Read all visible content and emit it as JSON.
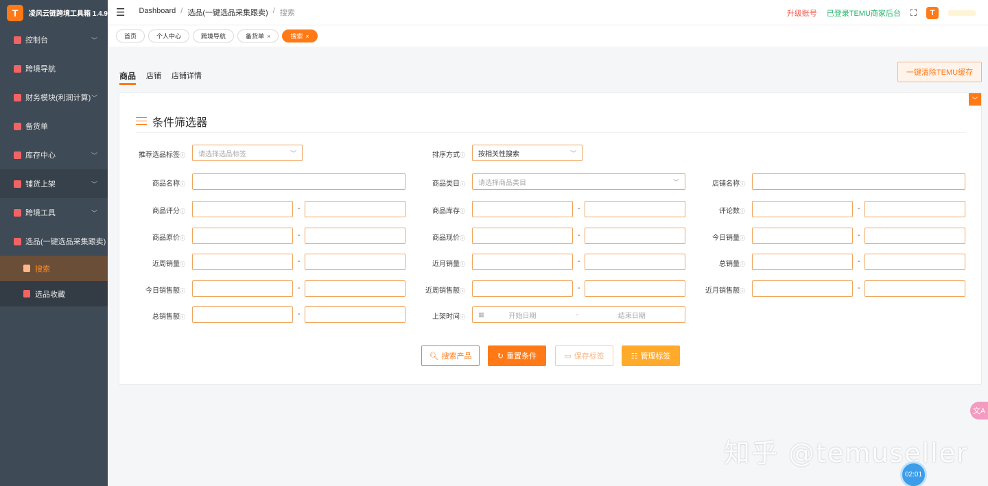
{
  "app": {
    "title": "凌风云链跨境工具箱 1.4.9",
    "logo_letter": "T"
  },
  "sidebar": {
    "items": [
      {
        "label": "控制台",
        "chevron": true
      },
      {
        "label": "跨境导航",
        "chevron": false
      },
      {
        "label": "财务模块(利润计算)",
        "chevron": true
      },
      {
        "label": "备货单",
        "chevron": false
      },
      {
        "label": "库存中心",
        "chevron": true
      },
      {
        "label": "铺货上架",
        "chevron": true
      },
      {
        "label": "跨境工具",
        "chevron": true
      },
      {
        "label": "选品(一键选品采集跟卖)",
        "chevron": false
      }
    ],
    "sub_items": [
      {
        "label": "搜索",
        "active": true
      },
      {
        "label": "选品收藏",
        "active": false
      }
    ]
  },
  "topbar": {
    "breadcrumb": [
      "Dashboard",
      "选品(一键选品采集跟卖)",
      "搜索"
    ],
    "upgrade": "升级账号",
    "logged_in": "已登录TEMU商家后台",
    "avatar_letter": "T"
  },
  "tags": [
    {
      "label": "首页",
      "closable": false,
      "active": false
    },
    {
      "label": "个人中心",
      "closable": false,
      "active": false
    },
    {
      "label": "跨境导航",
      "closable": false,
      "active": false
    },
    {
      "label": "备货单",
      "closable": true,
      "active": false
    },
    {
      "label": "搜索",
      "closable": true,
      "active": true
    }
  ],
  "subtabs": [
    "商品",
    "店铺",
    "店铺详情"
  ],
  "clear_cache_label": "一键清除TEMU缓存",
  "filter": {
    "title": "条件筛选器",
    "recommend_tag": {
      "label": "推荐选品标签",
      "placeholder": "请选择选品标签"
    },
    "sort": {
      "label": "排序方式",
      "value": "按相关性搜索"
    },
    "product_name": {
      "label": "商品名称"
    },
    "category": {
      "label": "商品类目",
      "placeholder": "请选择商品类目"
    },
    "shop_name": {
      "label": "店铺名称"
    },
    "ranges": {
      "rating": "商品评分",
      "stock": "商品库存",
      "reviews": "评论数",
      "orig_price": "商品原价",
      "cur_price": "商品现价",
      "today_sales": "今日销量",
      "week_sales": "近周销量",
      "month_sales": "近月销量",
      "total_sales": "总销量",
      "today_amount": "今日销售额",
      "week_amount": "近周销售额",
      "month_amount": "近月销售额",
      "total_amount": "总销售额"
    },
    "listing_time": {
      "label": "上架时间",
      "start": "开始日期",
      "end": "结束日期",
      "sep": "-"
    },
    "dash": "-"
  },
  "buttons": {
    "search": "搜索产品",
    "reset": "重置条件",
    "save": "保存标签",
    "manage": "管理标签"
  },
  "watermark": "知乎 @temuseller",
  "timer": "02:01",
  "float_label": "文A"
}
